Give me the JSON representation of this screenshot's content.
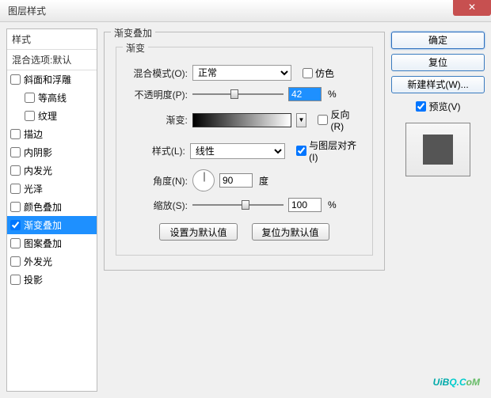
{
  "window": {
    "title": "图层样式"
  },
  "close_symbol": "✕",
  "left": {
    "header": "样式",
    "sub": "混合选项:默认",
    "items": [
      {
        "label": "斜面和浮雕",
        "indent": false
      },
      {
        "label": "等高线",
        "indent": true
      },
      {
        "label": "纹理",
        "indent": true
      },
      {
        "label": "描边",
        "indent": false
      },
      {
        "label": "内阴影",
        "indent": false
      },
      {
        "label": "内发光",
        "indent": false
      },
      {
        "label": "光泽",
        "indent": false
      },
      {
        "label": "颜色叠加",
        "indent": false
      },
      {
        "label": "渐变叠加",
        "indent": false,
        "selected": true,
        "checked": true
      },
      {
        "label": "图案叠加",
        "indent": false
      },
      {
        "label": "外发光",
        "indent": false
      },
      {
        "label": "投影",
        "indent": false
      }
    ]
  },
  "center": {
    "group_title": "渐变叠加",
    "inner_title": "渐变",
    "blend_label": "混合模式(O):",
    "blend_value": "正常",
    "dither_label": "仿色",
    "opacity_label": "不透明度(P):",
    "opacity_value": "42",
    "opacity_unit": "%",
    "gradient_label": "渐变:",
    "reverse_label": "反向(R)",
    "style_label": "样式(L):",
    "style_value": "线性",
    "align_label": "与图层对齐(I)",
    "align_checked": true,
    "angle_label": "角度(N):",
    "angle_value": "90",
    "angle_unit": "度",
    "scale_label": "缩放(S):",
    "scale_value": "100",
    "scale_unit": "%",
    "btn_default": "设置为默认值",
    "btn_reset": "复位为默认值"
  },
  "right": {
    "ok": "确定",
    "cancel": "复位",
    "new_style": "新建样式(W)...",
    "preview_label": "预览(V)",
    "preview_checked": true
  },
  "watermark": {
    "p1": "UiB",
    "p2": "Q.C",
    "p3": "oM"
  }
}
